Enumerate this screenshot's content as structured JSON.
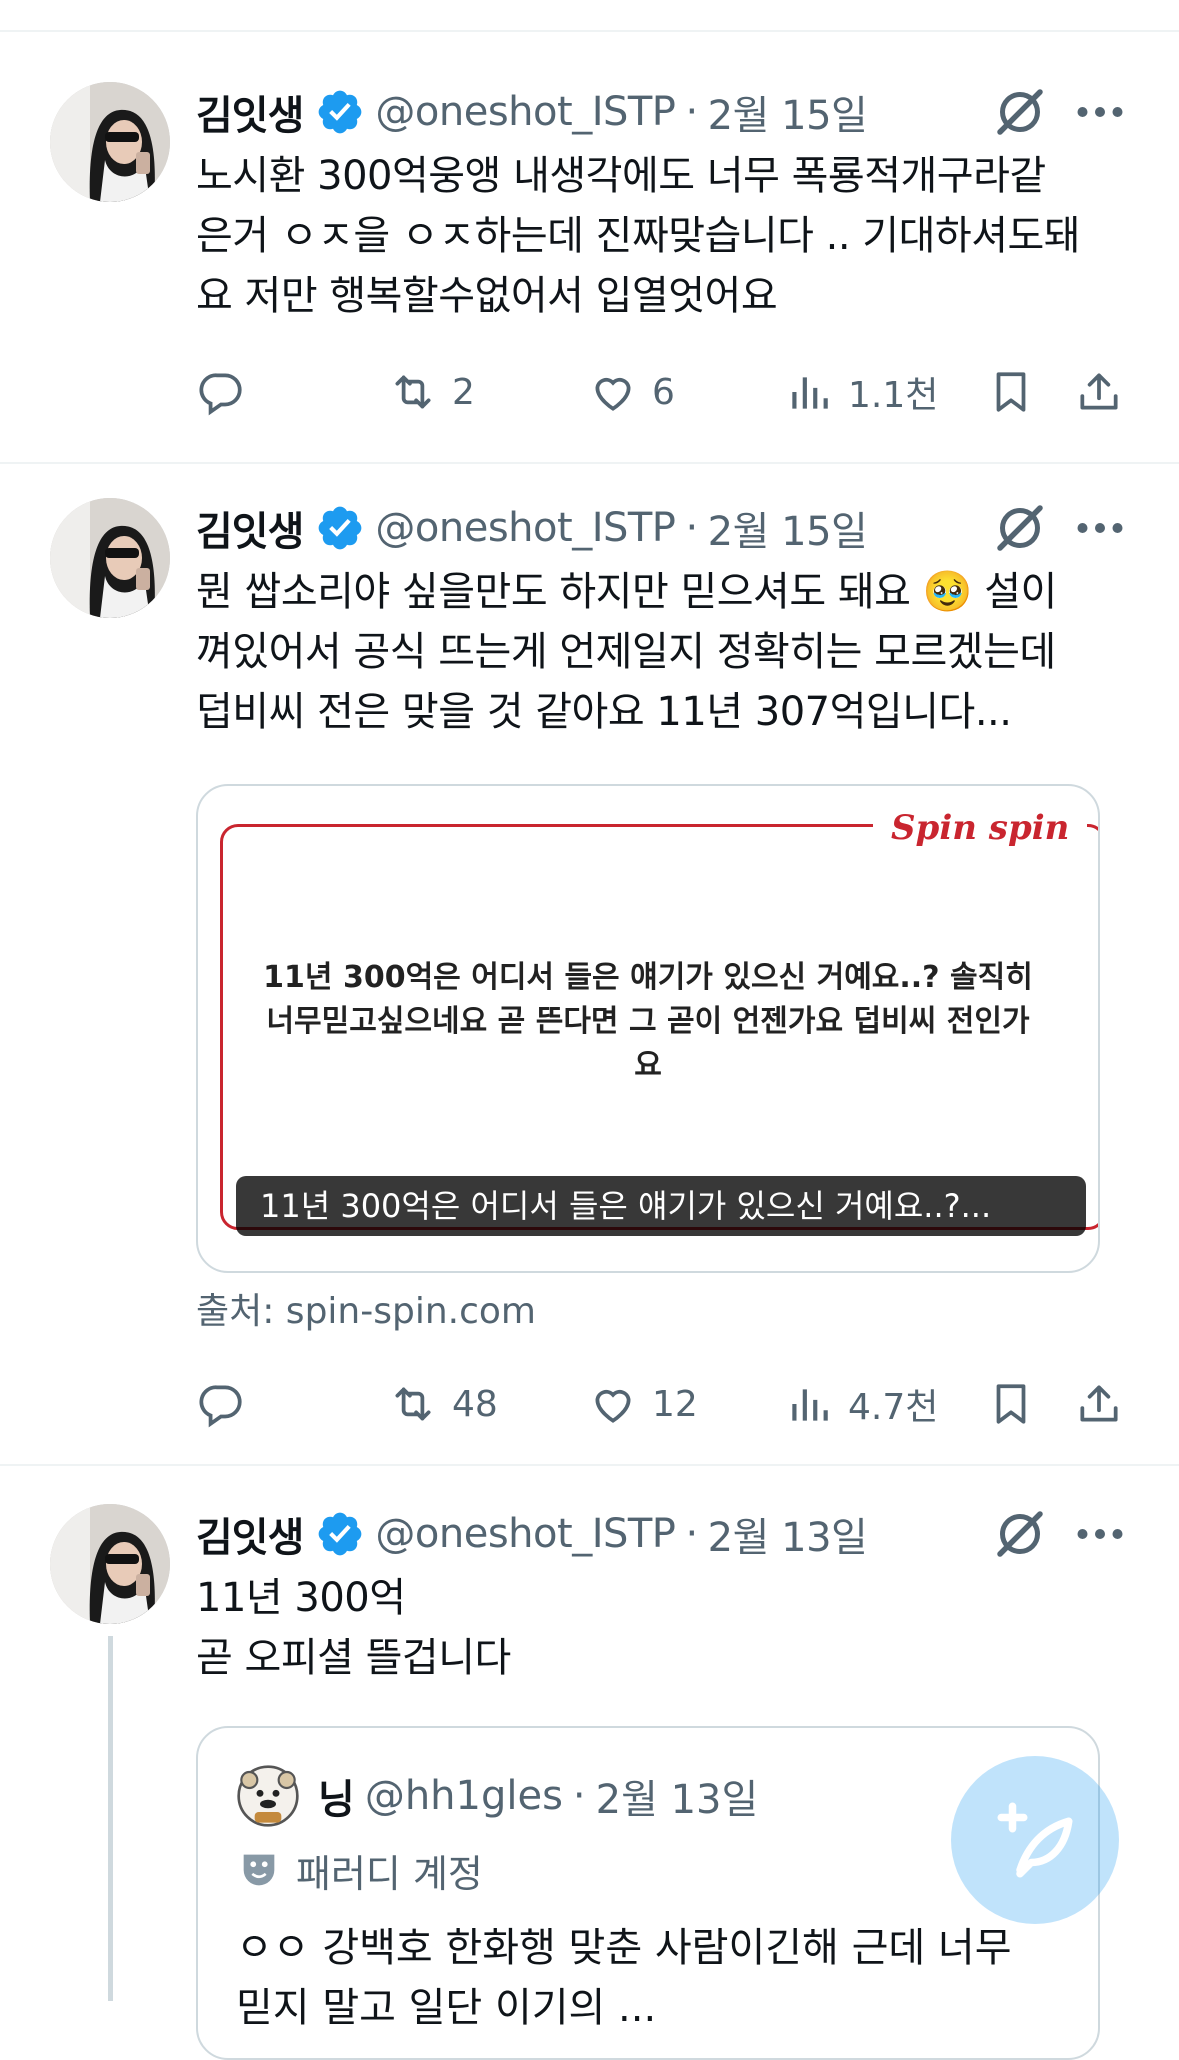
{
  "tweets": [
    {
      "name": "김잇생",
      "handle": "@oneshot_ISTP",
      "date": "2월 15일",
      "text": "노시환 300억웅앵 내생각에도 너무 폭룡적개구라같\n은거 ㅇㅈ을 ㅇㅈ하는데 진짜맞습니다 .. 기대하셔도돼\n요 저만 행복할수없어서 입열엇어요",
      "replies": "",
      "retweets": "2",
      "likes": "6",
      "views": "1.1천"
    },
    {
      "name": "김잇생",
      "handle": "@oneshot_ISTP",
      "date": "2월 15일",
      "text": "뭔 쌉소리야 싶을만도 하지만 믿으셔도 돼요 🥹 설이\n껴있어서 공식 뜨는게 언제일지 정확히는 모르겠는데\n덥비씨 전은 맞을 것 같아요 11년 307억입니다...",
      "card": {
        "brand": "Spin spin",
        "question": "11년 300억은 어디서 들은 얘기가 있으신 거예요..? 솔직히 너무믿고싶으네요 곧 뜬다면 그 곧이 언젠가요 덥비씨 전인가요",
        "caption": "11년 300억은 어디서 들은 얘기가 있으신 거예요..?...",
        "source": "출처: spin-spin.com"
      },
      "replies": "",
      "retweets": "48",
      "likes": "12",
      "views": "4.7천"
    },
    {
      "name": "김잇생",
      "handle": "@oneshot_ISTP",
      "date": "2월 13일",
      "text": "11년 300억\n곧 오피셜 뜰겁니다",
      "quote": {
        "name": "닝",
        "handle": "@hh1gles",
        "date": "2월 13일",
        "badge": "패러디 계정",
        "text": "ㅇㅇ 강백호  한화행 맞춘 사람이긴해   근데 너무\n믿지 말고 일단 이기의 ..."
      }
    }
  ],
  "colors": {
    "accent": "#1d9bf0",
    "secondary": "#536471",
    "brand_red": "#c9252f"
  },
  "icons": [
    "verified-badge-icon",
    "grok-icon",
    "more-icon",
    "reply-icon",
    "retweet-icon",
    "like-icon",
    "views-icon",
    "bookmark-icon",
    "share-icon",
    "parody-mask-icon",
    "compose-icon"
  ]
}
